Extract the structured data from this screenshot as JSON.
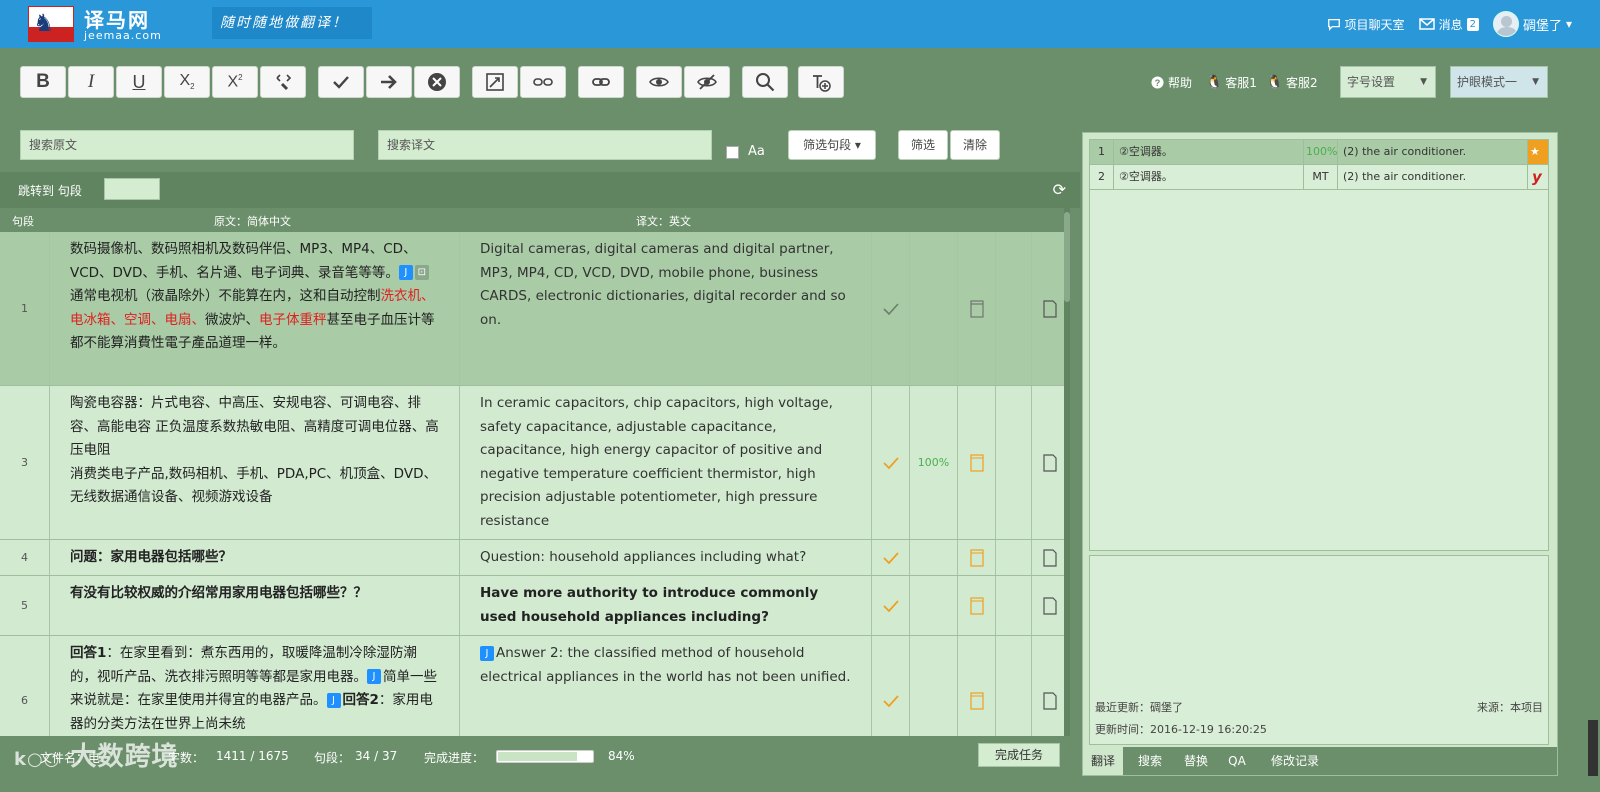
{
  "brand": {
    "cn": "译马网",
    "en": "jeemaa.com",
    "slogan": "随时随地做翻译！"
  },
  "topbar": {
    "chat": "项目聊天室",
    "messages": "消息",
    "messages_count": "2",
    "user": "碉堡了",
    "chevron": "▾"
  },
  "toolbar": {
    "help": "帮助",
    "service1": "客服1",
    "service2": "客服2",
    "font_size_select": "字号设置",
    "eye_mode_select": "护眼模式一"
  },
  "search": {
    "source_placeholder": "搜索原文",
    "target_placeholder": "搜索译文",
    "case_label": "Aa",
    "filter_button": "筛选句段 ▾",
    "filter": "筛选",
    "clear": "清除"
  },
  "jump": {
    "label": "跳转到 句段"
  },
  "table_header": {
    "seg": "句段",
    "source": "原文：简体中文",
    "target": "译文：英文"
  },
  "segments": [
    {
      "no": "1",
      "src_a": "数码摄像机、数码照相机及数码伴侣、MP3、MP4、CD、VCD、DVD、手机、名片通、电子词典、录音笔等等。",
      "src_b": "通常电视机（液晶除外）不能算在内，这和自动控制",
      "src_red1": "洗衣机、电冰箱、空调、电扇、",
      "src_c": "微波炉、",
      "src_red2": "电子体重秤",
      "src_d": "甚至电子血压计等都不能算消費性電子產品道理一样。",
      "tgt": "Digital cameras, digital cameras and digital partner, MP3, MP4, CD, VCD, DVD, mobile phone, business CARDS, electronic dictionaries, digital recorder and so on.",
      "pct": ""
    },
    {
      "no": "3",
      "src": "陶瓷电容器：片式电容、中高压、安规电容、可调电容、排容、高能电容 正负温度系数热敏电阻、高精度可调电位器、高压电阻\n消费类电子产品,数码相机、手机、PDA,PC、机顶盒、DVD、无线数据通信设备、视频游戏设备",
      "tgt": "In ceramic capacitors, chip capacitors, high voltage, safety capacitance, adjustable capacitance, capacitance, high energy capacitor of positive and negative temperature coefficient thermistor, high precision adjustable potentiometer, high pressure resistance",
      "pct": "100%"
    },
    {
      "no": "4",
      "src": "问题：家用电器包括哪些？",
      "tgt": "Question: household appliances including what?",
      "pct": ""
    },
    {
      "no": "5",
      "src": "有没有比较权威的介绍常用家用电器包括哪些？？",
      "tgt": "Have more authority to introduce commonly used household appliances including?",
      "pct": ""
    },
    {
      "no": "6",
      "src_a": "回答1",
      "src_b": "：在家里看到：煮东西用的，取暖降温制冷除湿防潮的，视听产品、洗衣排污照明等等都是家用电器。",
      "src_c": "简单一些来说就是：在家里使用并得宜的电器产品。",
      "src_d": "回答2",
      "src_e": "：家用电器的分类方法在世界上尚未统",
      "tgt": "Answer 2: the classified method of household electrical appliances in the world has not been unified.",
      "pct": ""
    }
  ],
  "tag_j": "J",
  "status": {
    "file_label": "文件名：电",
    "words_label": "字数：",
    "words": "1411 / 1675",
    "segs_label": "句段：",
    "segs": "34 / 37",
    "progress_label": "完成进度：",
    "progress_pct": "84%",
    "progress_value": 84,
    "finish": "完成任务"
  },
  "tm": {
    "rows": [
      {
        "no": "1",
        "src": "②空调器。",
        "match": "100%",
        "tgt": "(2) the air conditioner."
      },
      {
        "no": "2",
        "src": "②空调器。",
        "match": "MT",
        "tgt": "(2) the air conditioner."
      }
    ],
    "last_update_label": "最近更新：碉堡了",
    "source_label": "来源：本项目",
    "update_time": "更新时间：2016-12-19 16:20:25",
    "mt_logo": "y"
  },
  "rtabs": [
    "翻译",
    "搜索",
    "替换",
    "QA",
    "修改记录"
  ],
  "watermark": "大数跨境",
  "colors": {
    "topbar": "#2a97d8",
    "background": "#6b8f6b",
    "row": "#d1ead0",
    "active_row": "#a9cba6",
    "red_term": "#e02020",
    "check": "#f0a020"
  }
}
